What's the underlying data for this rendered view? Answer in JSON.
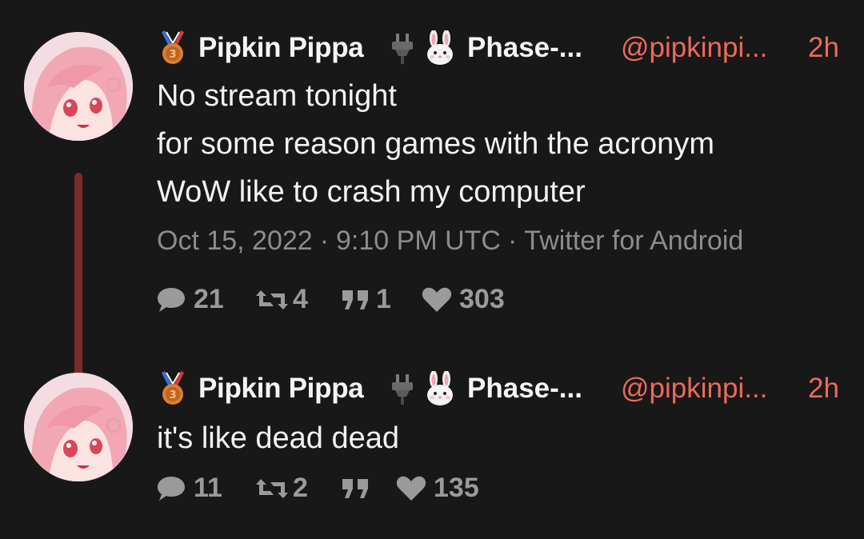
{
  "tweets": [
    {
      "author": {
        "name": "Pipkin Pippa",
        "display_suffix": "Phase-...",
        "handle": "@pipkinpi...",
        "age": "2h",
        "badges": [
          "medal-icon",
          "plug-icon",
          "bunny-icon"
        ]
      },
      "text_lines": [
        "No stream tonight",
        "for some reason games with the acronym",
        "WoW like to crash my computer"
      ],
      "meta": {
        "date": "Oct 15, 2022",
        "time": "9:10 PM UTC",
        "client": "Twitter for Android",
        "separator": "·"
      },
      "stats": {
        "replies": "21",
        "retweets": "4",
        "quotes": "1",
        "likes": "303"
      }
    },
    {
      "author": {
        "name": "Pipkin Pippa",
        "display_suffix": "Phase-...",
        "handle": "@pipkinpi...",
        "age": "2h",
        "badges": [
          "medal-icon",
          "plug-icon",
          "bunny-icon"
        ]
      },
      "text_lines": [
        "it's like dead dead"
      ],
      "stats": {
        "replies": "11",
        "retweets": "2",
        "quotes": "",
        "likes": "135"
      }
    }
  ],
  "colors": {
    "background": "#181818",
    "text": "#f2f2f2",
    "accent": "#ec6a5a",
    "muted": "#8c8c8c",
    "thread_line": "#7a2c2c"
  }
}
